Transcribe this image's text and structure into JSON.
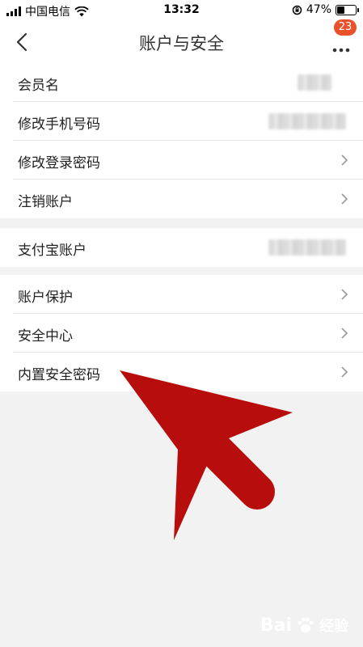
{
  "status_bar": {
    "carrier": "中国电信",
    "time": "13:32",
    "battery": "47%",
    "battery_level": 0.47
  },
  "nav": {
    "title": "账户与安全",
    "badge_count": "23"
  },
  "groups": [
    {
      "rows": [
        {
          "label": "会员名",
          "masked": true,
          "chevron": false
        },
        {
          "label": "修改手机号码",
          "masked": true,
          "chevron": false
        },
        {
          "label": "修改登录密码",
          "masked": false,
          "chevron": true
        },
        {
          "label": "注销账户",
          "masked": false,
          "chevron": true
        }
      ]
    },
    {
      "rows": [
        {
          "label": "支付宝账户",
          "masked": true,
          "chevron": false
        }
      ]
    },
    {
      "rows": [
        {
          "label": "账户保护",
          "masked": false,
          "chevron": true
        },
        {
          "label": "安全中心",
          "masked": false,
          "chevron": true
        },
        {
          "label": "内置安全密码",
          "masked": false,
          "chevron": true
        }
      ]
    }
  ],
  "watermark": {
    "text": "Bai",
    "suffix": "经验"
  },
  "colors": {
    "accent": "#e8512a",
    "arrow": "#b80d0d",
    "background": "#f2f2f2"
  }
}
